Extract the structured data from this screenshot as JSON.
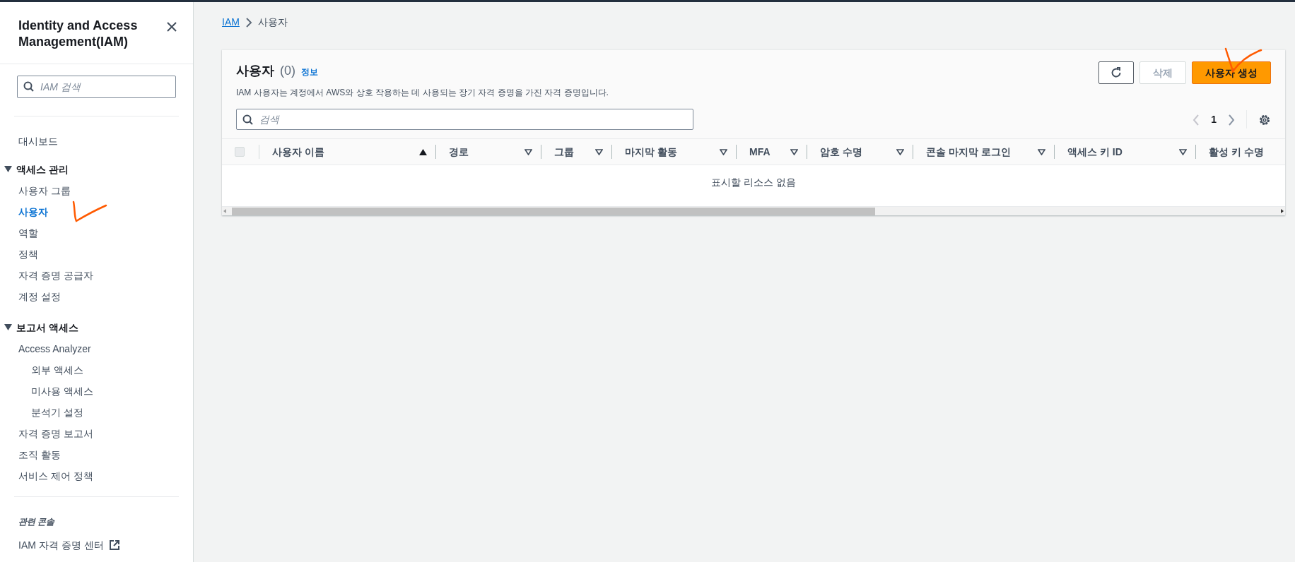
{
  "sidebar": {
    "title": "Identity and Access Management(IAM)",
    "search": {
      "placeholder": "IAM 검색"
    },
    "nav": [
      {
        "kind": "link",
        "label": "대시보드",
        "selected": false
      },
      {
        "kind": "section",
        "label": "액세스 관리",
        "expanded": true,
        "children": [
          {
            "label": "사용자 그룹",
            "selected": false
          },
          {
            "label": "사용자",
            "selected": true
          },
          {
            "label": "역할",
            "selected": false
          },
          {
            "label": "정책",
            "selected": false
          },
          {
            "label": "자격 증명 공급자",
            "selected": false
          },
          {
            "label": "계정 설정",
            "selected": false
          }
        ]
      },
      {
        "kind": "section",
        "label": "보고서 액세스",
        "expanded": true,
        "children": [
          {
            "label": "Access Analyzer",
            "selected": false,
            "children": [
              {
                "label": "외부 액세스",
                "selected": false
              },
              {
                "label": "미사용 액세스",
                "selected": false
              },
              {
                "label": "분석기 설정",
                "selected": false
              }
            ]
          },
          {
            "label": "자격 증명 보고서",
            "selected": false
          },
          {
            "label": "조직 활동",
            "selected": false
          },
          {
            "label": "서비스 제어 정책",
            "selected": false
          }
        ]
      }
    ],
    "related": {
      "heading": "관련 콘솔",
      "links": [
        {
          "label": "IAM 자격 증명 센터",
          "external": true
        }
      ]
    }
  },
  "breadcrumb": [
    {
      "label": "IAM",
      "link": true
    },
    {
      "label": "사용자",
      "link": false
    }
  ],
  "panel": {
    "title": "사용자",
    "count": "(0)",
    "info": "정보",
    "description": "IAM 사용자는 계정에서 AWS와 상호 작용하는 데 사용되는 장기 자격 증명을 가진 자격 증명입니다.",
    "buttons": [
      {
        "kind": "refresh",
        "disabled": false
      },
      {
        "kind": "text",
        "label": "삭제",
        "disabled": true
      },
      {
        "kind": "primary",
        "label": "사용자 생성",
        "disabled": false
      }
    ],
    "search": {
      "placeholder": "검색"
    },
    "pagination": {
      "page": "1",
      "prev_disabled": true,
      "next_disabled": false
    },
    "table": {
      "select_all": {
        "checked": false
      },
      "columns": [
        {
          "label": "사용자 이름",
          "sorted": true
        },
        {
          "label": "경로",
          "sorted": false
        },
        {
          "label": "그룹",
          "sorted": false
        },
        {
          "label": "마지막 활동",
          "sorted": false
        },
        {
          "label": "MFA",
          "sorted": false
        },
        {
          "label": "암호 수명",
          "sorted": false
        },
        {
          "label": "콘솔 마지막 로그인",
          "sorted": false
        },
        {
          "label": "액세스 키 ID",
          "sorted": false
        },
        {
          "label": "활성 키 수명"
        }
      ],
      "empty_message": "표시할 리소스 없음"
    }
  }
}
